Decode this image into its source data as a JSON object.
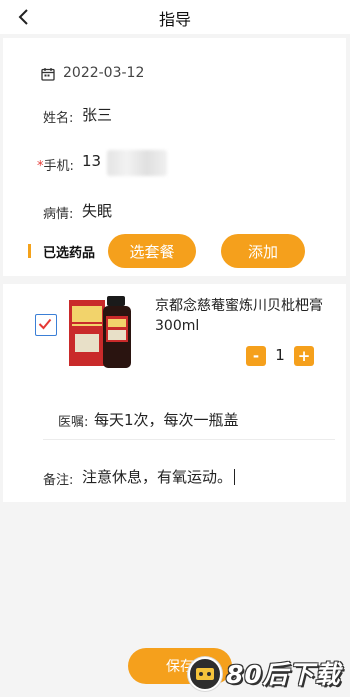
{
  "header": {
    "title": "指导"
  },
  "info": {
    "date": "2022-03-12",
    "name_label": "姓名:",
    "name_value": "张三",
    "phone_star": "*",
    "phone_label": "手机:",
    "phone_value": "13",
    "condition_label": "病情:",
    "condition_value": "失眠"
  },
  "medicine_section": {
    "title": "已选药品",
    "combo_button": "选套餐",
    "add_button": "添加"
  },
  "medicine_item": {
    "checked": true,
    "name": "京都念慈菴蜜炼川贝枇杷膏300ml",
    "quantity": "1",
    "minus_label": "-",
    "plus_label": "+",
    "advice_label": "医嘱:",
    "advice_value": "每天1次，每次一瓶盖",
    "note_label": "备注:",
    "note_value": "注意休息，有氧运动。"
  },
  "footer": {
    "save_button": "保存"
  },
  "watermark": {
    "text": "80后下载"
  },
  "colors": {
    "accent": "#f5a01c",
    "checkbox_border": "#3b7fd6",
    "check_mark": "#e53935"
  }
}
